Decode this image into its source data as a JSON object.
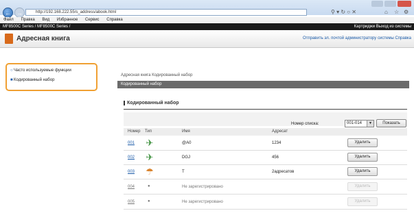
{
  "browser": {
    "address": "http://192.168.222.55/s_address/abook.html",
    "menu": [
      "Файл",
      "Правка",
      "Вид",
      "Избранное",
      "Сервис",
      "Справка"
    ]
  },
  "device": {
    "name": "MF8500C Series / MF8500C Series /",
    "right": "Картриджи   Выход из системы"
  },
  "header": {
    "title": "Адресная книга",
    "links": "Отправить эл. почтой администратору системы  Справка"
  },
  "sidebar": {
    "items": [
      {
        "label": "Часто используемые функции"
      },
      {
        "label": "Кодированный набор"
      }
    ]
  },
  "breadcrumb": "Адресная книга Кодированный набор",
  "section_title": "Кодированный набор",
  "subheading": "Кодированный набор",
  "list": {
    "label": "Номер списка:",
    "selected": "001-014",
    "show_button": "Показать"
  },
  "table": {
    "headers": [
      "Номер",
      "Тип",
      "Имя",
      "Адресат"
    ],
    "rows": [
      {
        "num": "001",
        "type_icon": "fax-icon",
        "name": "@A0",
        "addr": "1234",
        "action": "Удалить"
      },
      {
        "num": "002",
        "type_icon": "fax-icon",
        "name": "DGJ",
        "addr": "456",
        "action": "Удалить"
      },
      {
        "num": "003",
        "type_icon": "group-icon",
        "name": "T",
        "addr": "2адресатов",
        "action": "Удалить"
      },
      {
        "num": "004",
        "type_icon": "dot",
        "name": "Не зарегистрировано",
        "addr": "",
        "action": "Удалить"
      },
      {
        "num": "005",
        "type_icon": "dot",
        "name": "Не зарегистрировано",
        "addr": "",
        "action": "Удалить"
      }
    ]
  }
}
